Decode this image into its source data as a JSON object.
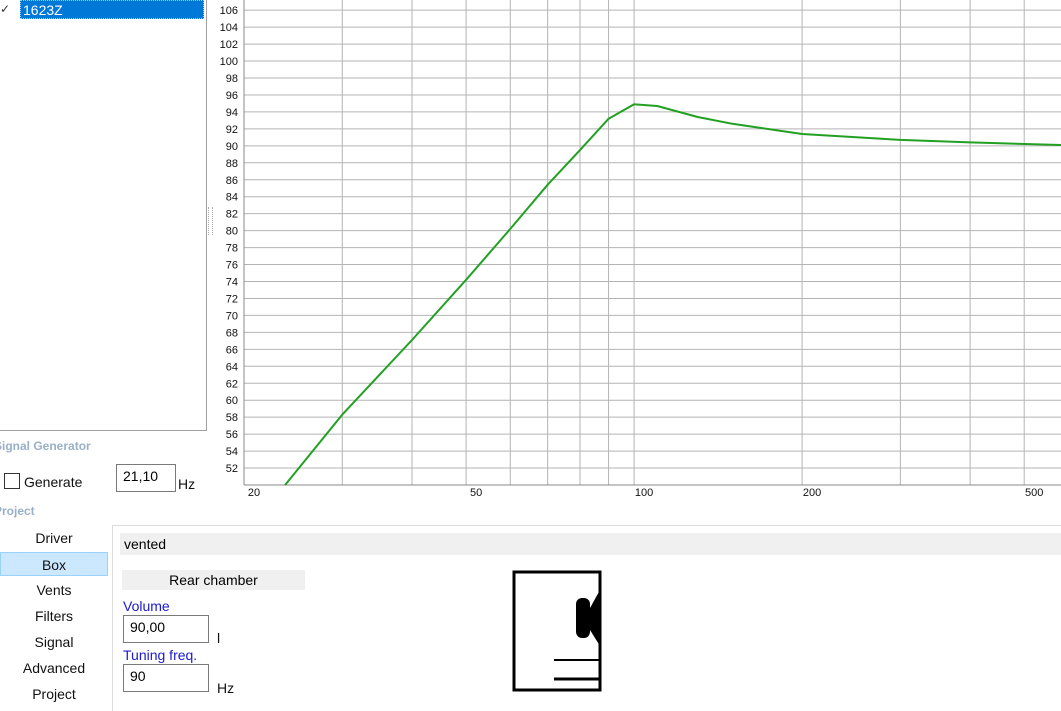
{
  "drivers": [
    {
      "name": "1623Z",
      "checked": true
    }
  ],
  "signal_generator": {
    "title": "Signal Generator",
    "generate_label": "Generate",
    "generate_checked": false,
    "frequency": "21,10",
    "unit": "Hz"
  },
  "project": {
    "title": "Project",
    "nav": [
      {
        "label": "Driver"
      },
      {
        "label": "Box",
        "selected": true
      },
      {
        "label": "Vents"
      },
      {
        "label": "Filters"
      },
      {
        "label": "Signal"
      },
      {
        "label": "Advanced"
      },
      {
        "label": "Project"
      }
    ]
  },
  "box": {
    "type": "vented",
    "section": "Rear chamber",
    "volume_label": "Volume",
    "volume": "90,00",
    "volume_unit": "l",
    "tuning_label": "Tuning freq.",
    "tuning": "90",
    "tuning_unit": "Hz"
  },
  "chart_data": {
    "type": "line",
    "xscale": "log",
    "xlim": [
      20,
      582
    ],
    "ylim": [
      50,
      107.2
    ],
    "yticks": [
      52,
      54,
      56,
      58,
      60,
      62,
      64,
      66,
      68,
      70,
      72,
      74,
      76,
      78,
      80,
      82,
      84,
      86,
      88,
      90,
      92,
      94,
      96,
      98,
      100,
      102,
      104,
      106
    ],
    "xgrid": [
      20,
      30,
      40,
      50,
      60,
      70,
      80,
      90,
      100,
      200,
      300,
      400,
      500
    ],
    "xtick_labels": [
      "20",
      "50",
      "100",
      "200",
      "500"
    ],
    "series": [
      {
        "name": "1623Z",
        "color": "#22a022",
        "x": [
          23.7,
          30,
          40,
          50,
          60,
          70,
          80,
          90,
          100,
          110,
          130,
          150,
          200,
          300,
          400,
          582
        ],
        "y": [
          50,
          58.3,
          67.1,
          74.2,
          80.2,
          85.4,
          89.5,
          93.2,
          94.9,
          94.7,
          93.4,
          92.6,
          91.4,
          90.7,
          90.4,
          90.1
        ]
      }
    ]
  }
}
